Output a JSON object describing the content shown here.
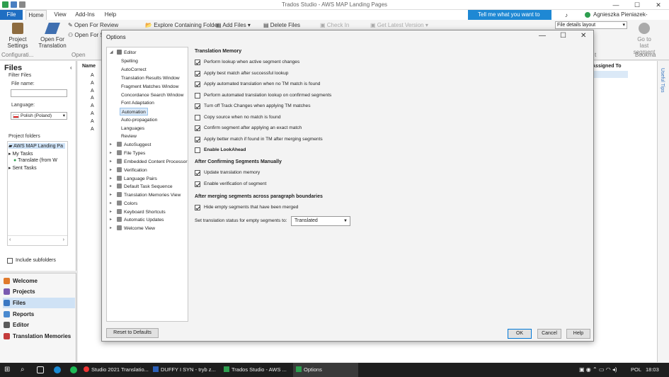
{
  "window": {
    "title": "Trados Studio - AWS MAP Landing Pages",
    "controls": [
      "—",
      "☐",
      "✕"
    ]
  },
  "tabs": [
    "File",
    "Home",
    "View",
    "Add-Ins",
    "Help"
  ],
  "tellme": "Tell me what you want to do...",
  "user": "Agnieszka Pieniazek-Siekierska",
  "ribbon": {
    "project_settings": "Project Settings",
    "open_for_translation": "Open For Translation",
    "open_for_review": "Open For Review",
    "open_for_s": "Open For S",
    "explore_containing_folder": "Explore Containing Folder",
    "add_files": "Add Files",
    "delete_files": "Delete Files",
    "check_in": "Check In",
    "get_latest_version": "Get Latest Version",
    "layout_value": "File details layout",
    "go_to_last": "Go to last segment",
    "groups": {
      "configuration": "Configurati...",
      "open": "Open",
      "bookmarks": "Bookma",
      "t": "t"
    }
  },
  "files_pane": {
    "title": "Files",
    "filter_files": "Filter Files",
    "file_name": "File name:",
    "language": "Language:",
    "language_value": "Polish (Poland)",
    "project_folders": "Project folders",
    "tree": [
      "AWS MAP Landing Pa",
      "My Tasks",
      "Translate (from W",
      "Sent Tasks"
    ],
    "include_subfolders": "Include subfolders"
  },
  "nav": [
    "Welcome",
    "Projects",
    "Files",
    "Reports",
    "Editor",
    "Translation Memories"
  ],
  "grid": {
    "col_name": "Name",
    "col_assigned": "Assigned To",
    "row_letter": "A"
  },
  "right_tab": "Useful Tips",
  "dialog": {
    "title": "Options",
    "tree": {
      "editor": "Editor",
      "editor_children": [
        "Spelling",
        "AutoCorrect",
        "Translation Results Window",
        "Fragment Matches Window",
        "Concordance Search Window",
        "Font Adaptation",
        "Automation",
        "Auto-propagation",
        "Languages",
        "Review"
      ],
      "top": [
        "AutoSuggest",
        "File Types",
        "Embedded Content Processor",
        "Verification",
        "Language Pairs",
        "Default Task Sequence",
        "Translation Memories View",
        "Colors",
        "Keyboard Shortcuts",
        "Automatic Updates",
        "Welcome View"
      ]
    },
    "sections": {
      "tm": "Translation Memory",
      "after_confirm": "After Confirming Segments Manually",
      "after_merge": "After merging segments across paragraph boundaries"
    },
    "tm_options": [
      {
        "label": "Perform lookup when active segment changes",
        "checked": true
      },
      {
        "label": "Apply best match after successful lookup",
        "checked": true
      },
      {
        "label": "Apply automated translation when no TM match is found",
        "checked": true
      },
      {
        "label": "Perform automated translation lookup on confirmed segments",
        "checked": false
      },
      {
        "label": "Turn off Track Changes when applying TM matches",
        "checked": true
      },
      {
        "label": "Copy source when no match is found",
        "checked": false
      },
      {
        "label": "Confirm segment after applying an exact match",
        "checked": true
      },
      {
        "label": "Apply better match if found in TM after merging segments",
        "checked": true
      },
      {
        "label": "Enable LookAhead",
        "checked": false,
        "bold": true
      }
    ],
    "confirm_options": [
      {
        "label": "Update translation memory",
        "checked": true
      },
      {
        "label": "Enable verification of segment",
        "checked": true
      }
    ],
    "merge_options": [
      {
        "label": "Hide empty segments that have been merged",
        "checked": true
      }
    ],
    "status_label": "Set translation status for empty segments to:",
    "status_value": "Translated",
    "buttons": {
      "reset": "Reset to Defaults",
      "ok": "OK",
      "cancel": "Cancel",
      "help": "Help"
    }
  },
  "taskbar": {
    "items": [
      "Studio 2021 Translatio...",
      "DUFFY I SYN  -  tryb z...",
      "Trados Studio - AWS ...",
      "Options"
    ],
    "lang": "POL",
    "time": "18:03"
  }
}
